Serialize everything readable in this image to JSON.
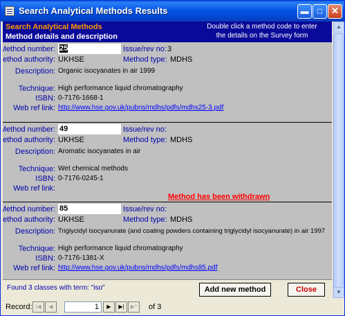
{
  "window": {
    "title": "Search Analytical Methods Results"
  },
  "header": {
    "title": "Search Analytical Methods",
    "subtitle": "Method details and description",
    "instruction": "Double click a method code  to enter the details on the Survey form"
  },
  "labels": {
    "method_number": "Method number:",
    "issue_rev": "Issue/rev no:",
    "method_authority": "Method authority:",
    "method_type": "Method type:",
    "description": "Description:",
    "technique": "Technique:",
    "isbn": "ISBN:",
    "web_ref": "Web ref link:"
  },
  "records": [
    {
      "method_number": "25",
      "issue_rev": "3",
      "authority": "UKHSE",
      "type": "MDHS",
      "description": "Organic isocyanates in air 1999",
      "technique": "High performance liquid chromatography",
      "isbn": "0-7176-1668-1",
      "web_ref": "http://www.hse.gov.uk/pubns/mdhs/pdfs/mdhs25-3.pdf",
      "withdrawn": ""
    },
    {
      "method_number": "49",
      "issue_rev": "",
      "authority": "UKHSE",
      "type": "MDHS",
      "description": "Aromatic isocyanates in air",
      "technique": "Wet chemical methods",
      "isbn": "0-7176-0245-1",
      "web_ref": "",
      "withdrawn": "Method has been withdrawn"
    },
    {
      "method_number": "85",
      "issue_rev": "",
      "authority": "UKHSE",
      "type": "MDHS",
      "description": "Triglycidyl isocyanurate (and coating powders containing triglycidyl isocyanurate) in air 1997",
      "technique": "High performance liquid chromatography",
      "isbn": "0-7176-1381-X",
      "web_ref": "http://www.hse.gov.uk/pubns/mdhs/pdfs/mdhs85.pdf",
      "withdrawn": ""
    }
  ],
  "footer": {
    "found_text": "Found 3 classes with term: \"iso\"",
    "add_button": "Add new method",
    "close_button": "Close"
  },
  "navigation": {
    "label": "Record:",
    "current": "1",
    "of_text": "of  3"
  },
  "colors": {
    "header_bg": "#0a0a9a",
    "header_title": "#ff9900",
    "label_text": "#0000aa",
    "link": "#0000ff",
    "withdrawn": "#ff0000",
    "close_button_text": "#cc0000"
  }
}
